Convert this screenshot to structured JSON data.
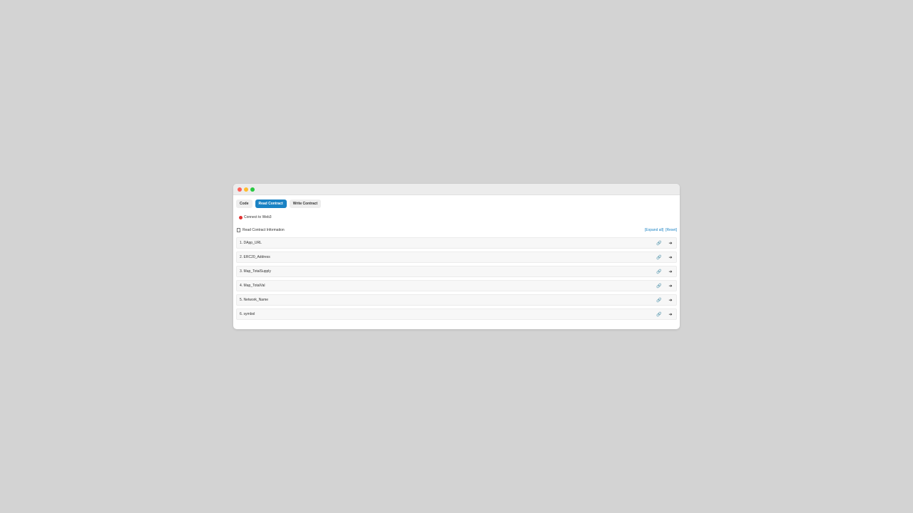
{
  "tabs": [
    {
      "label": "Code",
      "active": false
    },
    {
      "label": "Read Contract",
      "active": true
    },
    {
      "label": "Write Contract",
      "active": false
    }
  ],
  "connect": {
    "label": "Connect to Web3",
    "status_color": "#e03131"
  },
  "info": {
    "title": "Read Contract Information",
    "expand_all": "[Expand all]",
    "reset": "[Reset]"
  },
  "functions": [
    {
      "label": "1. DApp_URL"
    },
    {
      "label": "2. ERC20_Address"
    },
    {
      "label": "3. Map_TotalSupply"
    },
    {
      "label": "4. Map_TotalVal"
    },
    {
      "label": "5. Network_Name"
    },
    {
      "label": "6. symbol"
    }
  ],
  "icons": {
    "link": "link-icon",
    "arrow": "arrow-right-icon"
  },
  "colors": {
    "accent": "#1a82c4",
    "background": "#d3d3d3"
  }
}
